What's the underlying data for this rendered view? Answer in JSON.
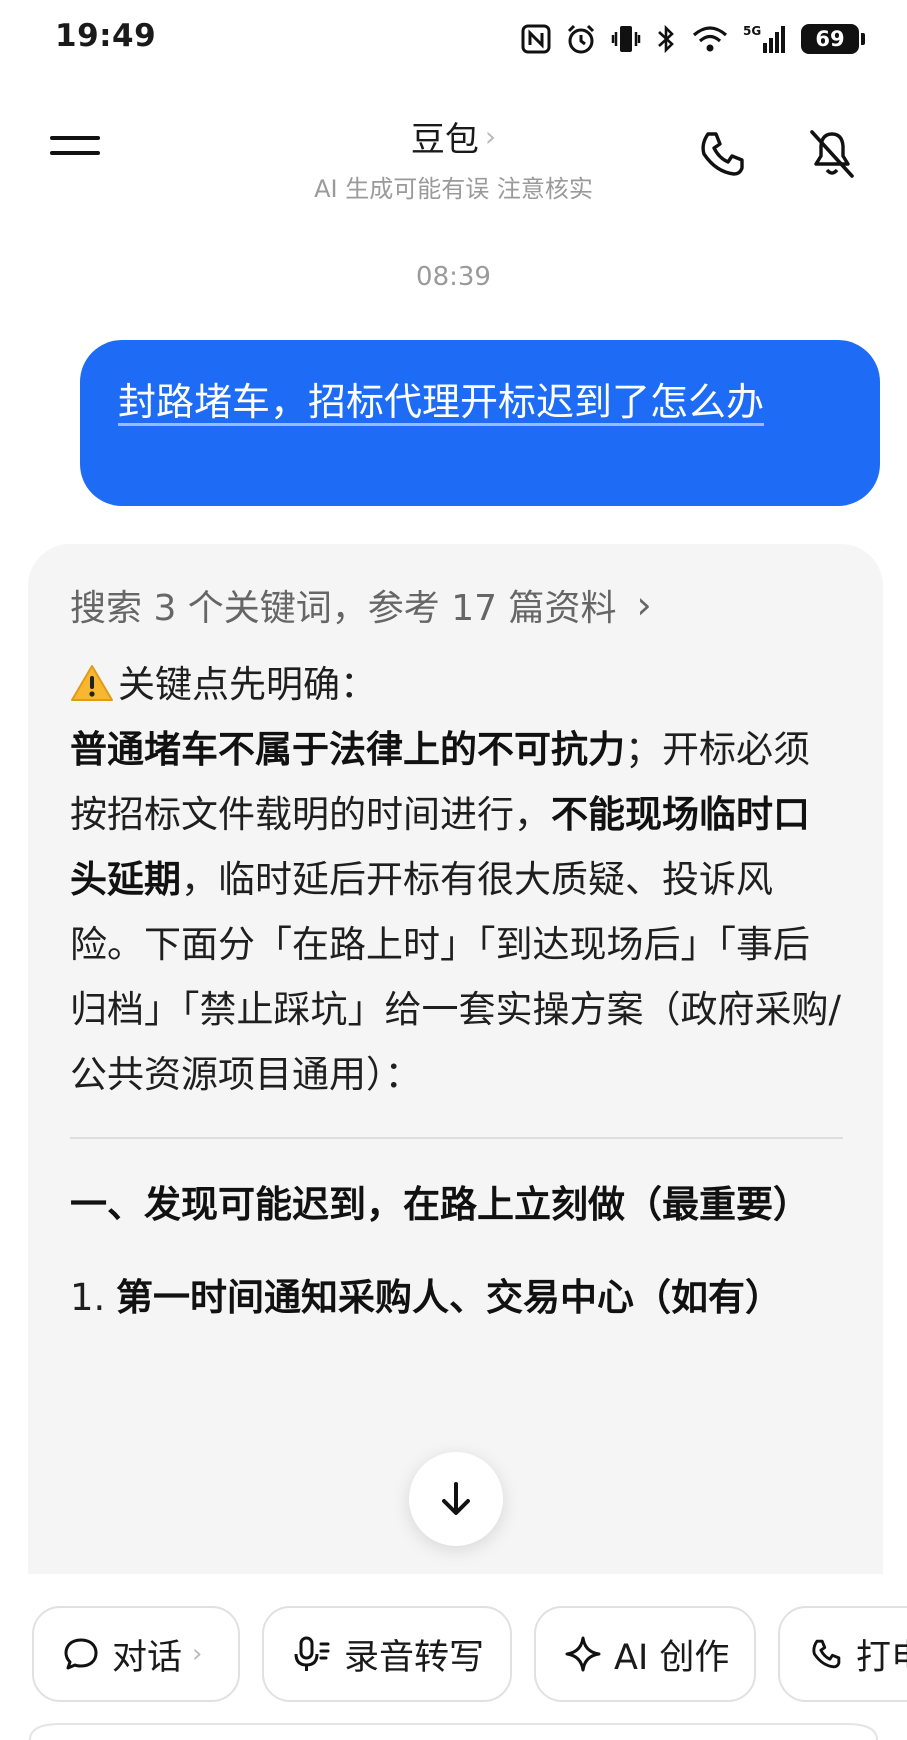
{
  "status_bar": {
    "time": "19:49",
    "battery": "69",
    "icons": [
      "nfc-icon",
      "alarm-icon",
      "vibrate-icon",
      "bluetooth-icon",
      "wifi-icon",
      "signal-5g-icon",
      "battery-icon"
    ]
  },
  "header": {
    "title": "豆包",
    "subtitle": "AI 生成可能有误 注意核实",
    "icons": [
      "menu-icon",
      "phone-icon",
      "speaker-muted-icon"
    ]
  },
  "chat": {
    "timestamp": "08:39",
    "user_message": "封路堵车，招标代理开标迟到了怎么办",
    "ai": {
      "search_summary": "搜索 3 个关键词，参考 17 篇资料",
      "intro_heading": "关键点先明确：",
      "para_bold_1": "普通堵车不属于法律上的不可抗力",
      "para_text_1": "；开标必须按招标文件载明的时间进行，",
      "para_bold_2": "不能现场临时口头延期",
      "para_text_2": "，临时延后开标有很大质疑、投诉风险。下面分「在路上时」「到达现场后」「事后归档」「禁止踩坑」给一套实操方案（政府采购/公共资源项目通用）：",
      "section_1_title": "一、发现可能迟到，在路上立刻做（最重要）",
      "list_item_1_number": "1.",
      "list_item_1_text": "第一时间通知采购人、交易中心（如有）"
    }
  },
  "toolbar": {
    "chat": "对话",
    "transcribe": "录音转写",
    "ai_create": "AI 创作",
    "call": "打电话"
  },
  "colors": {
    "accent": "#1e6cf5",
    "card_bg": "#f5f5f5",
    "muted_text": "#9a9a9a"
  }
}
